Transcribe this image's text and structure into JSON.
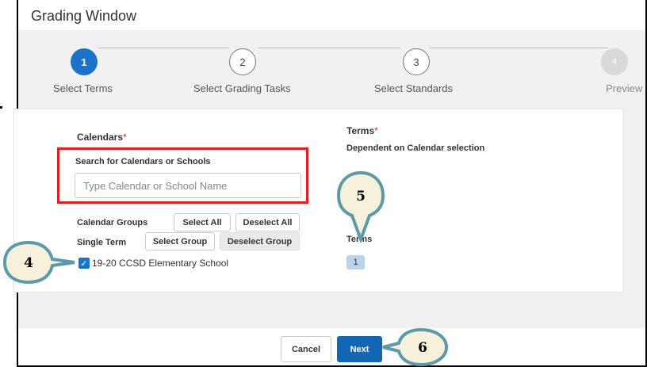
{
  "window": {
    "title": "Grading Window"
  },
  "stepper": {
    "steps": [
      {
        "number": "1",
        "label": "Select Terms",
        "state": "active"
      },
      {
        "number": "2",
        "label": "Select Grading Tasks",
        "state": "todo"
      },
      {
        "number": "3",
        "label": "Select Standards",
        "state": "todo"
      },
      {
        "number": "4",
        "label": "Preview",
        "state": "disabled"
      }
    ]
  },
  "calendars": {
    "label": "Calendars",
    "required_mark": "*",
    "search_label": "Search for Calendars or Schools",
    "search_placeholder": "Type Calendar or School Name",
    "search_value": "",
    "calendar_groups_label": "Calendar Groups",
    "select_all": "Select All",
    "deselect_all": "Deselect All",
    "single_term_label": "Single Term",
    "select_group": "Select Group",
    "deselect_group": "Deselect Group",
    "item": {
      "label": "19-20 CCSD Elementary School",
      "checked": true
    }
  },
  "terms": {
    "label": "Terms",
    "required_mark": "*",
    "hint": "Dependent on Calendar selection",
    "list_label": "Terms",
    "term_badge": "1"
  },
  "footer": {
    "cancel": "Cancel",
    "next": "Next"
  },
  "callouts": {
    "four": "4",
    "five": "5",
    "six": "6"
  },
  "colors": {
    "accent": "#1a73c9",
    "callout_fill": "#f7f1dc",
    "callout_border": "#5b9aa8",
    "highlight": "#e02020"
  }
}
